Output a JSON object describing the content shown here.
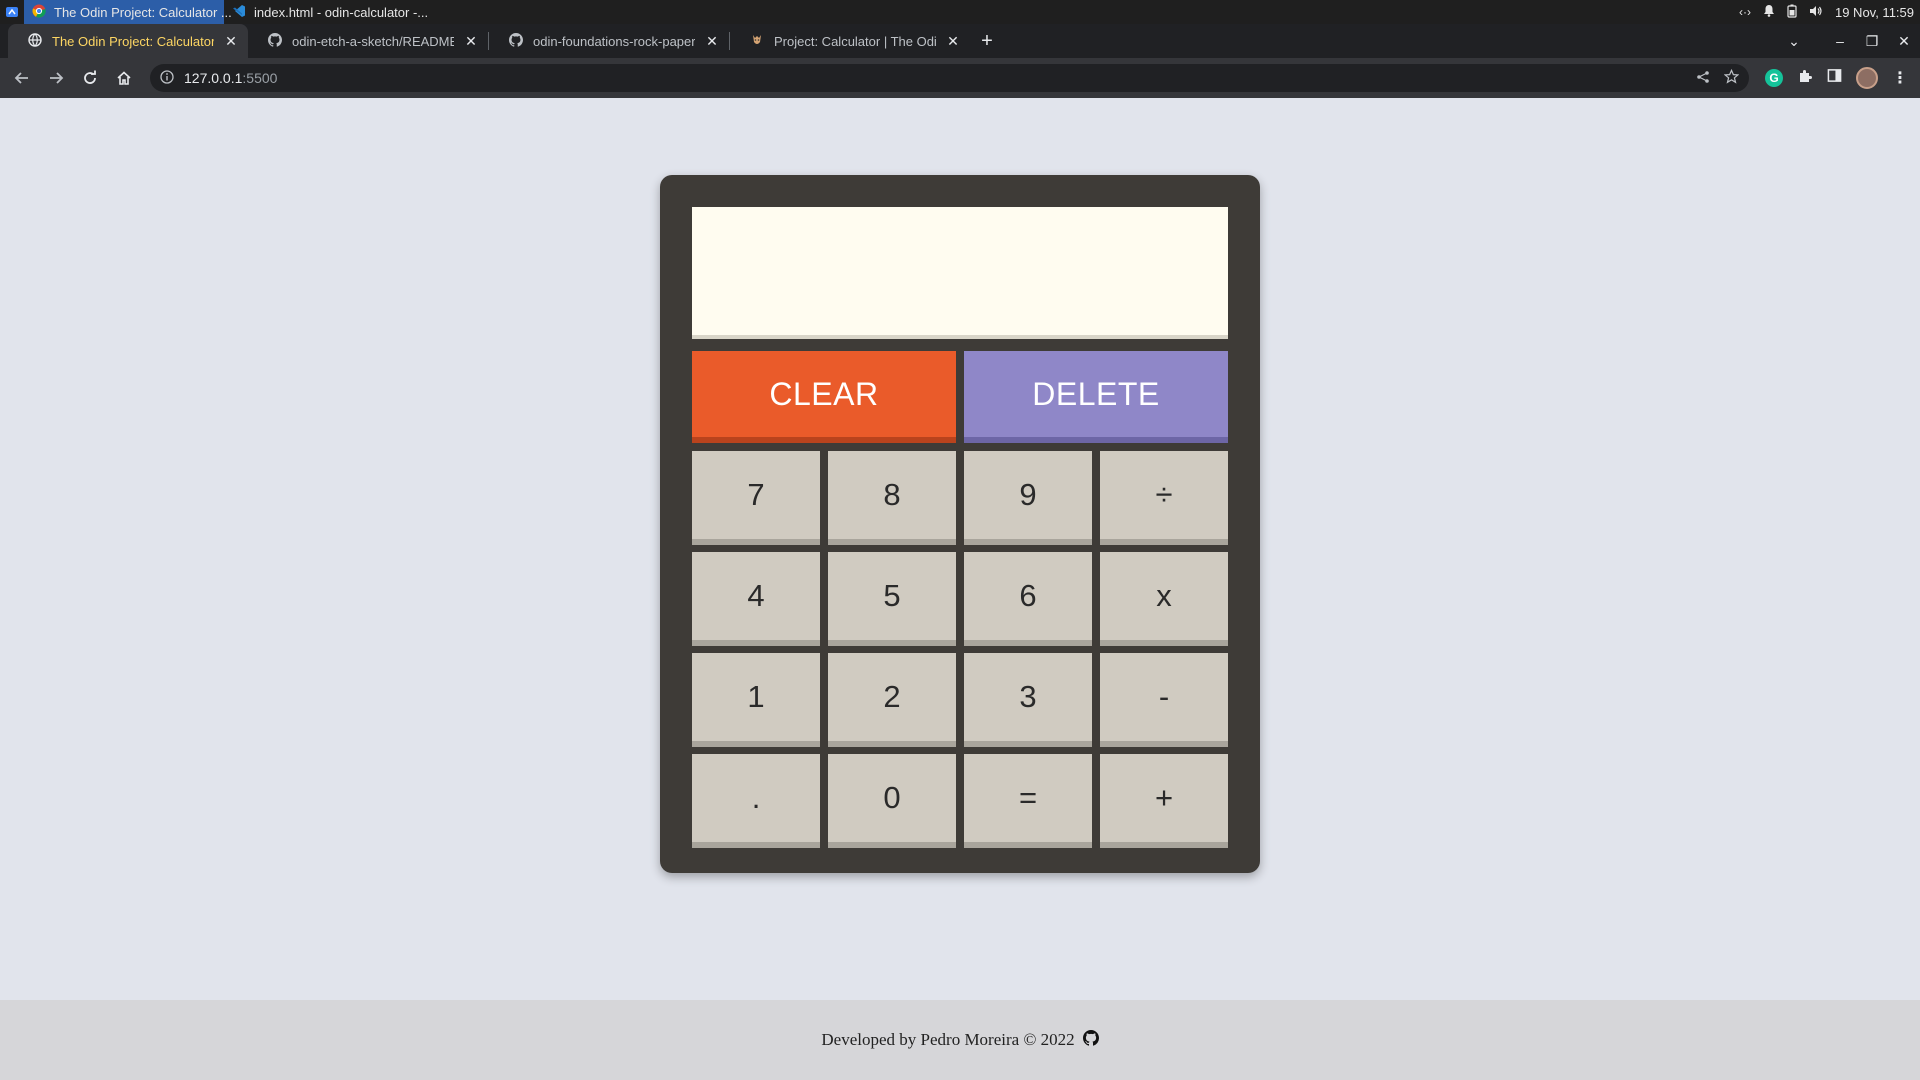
{
  "os": {
    "tasks": [
      {
        "label": "The Odin Project: Calculator ...",
        "icon": "chrome-icon"
      },
      {
        "label": "index.html - odin-calculator -...",
        "icon": "vscode-icon"
      }
    ],
    "clock": "19 Nov, 11:59"
  },
  "browser": {
    "tabs": [
      {
        "label": "The Odin Project: Calculator",
        "active": true
      },
      {
        "label": "odin-etch-a-sketch/README.md",
        "active": false
      },
      {
        "label": "odin-foundations-rock-paper-sc",
        "active": false
      },
      {
        "label": "Project: Calculator | The Odin P",
        "active": false
      }
    ],
    "new_tab": "+",
    "url_host": "127.0.0.1",
    "url_port": ":5500"
  },
  "calculator": {
    "display_value": "",
    "clear_label": "CLEAR",
    "delete_label": "DELETE",
    "keys": [
      {
        "label": "7",
        "name": "key-7"
      },
      {
        "label": "8",
        "name": "key-8"
      },
      {
        "label": "9",
        "name": "key-9"
      },
      {
        "label": "÷",
        "name": "key-divide"
      },
      {
        "label": "4",
        "name": "key-4"
      },
      {
        "label": "5",
        "name": "key-5"
      },
      {
        "label": "6",
        "name": "key-6"
      },
      {
        "label": "x",
        "name": "key-multiply"
      },
      {
        "label": "1",
        "name": "key-1"
      },
      {
        "label": "2",
        "name": "key-2"
      },
      {
        "label": "3",
        "name": "key-3"
      },
      {
        "label": "-",
        "name": "key-subtract"
      },
      {
        "label": ".",
        "name": "key-decimal"
      },
      {
        "label": "0",
        "name": "key-0"
      },
      {
        "label": "=",
        "name": "key-equals"
      },
      {
        "label": "+",
        "name": "key-add"
      }
    ]
  },
  "footer": {
    "text": "Developed by Pedro Moreira © 2022",
    "icon": "github-icon"
  },
  "colors": {
    "page_bg": "#e1e4ec",
    "calculator_body": "#3e3b37",
    "display_bg": "#fffcf0",
    "clear_button": "#ea5b2a",
    "delete_button": "#8f87c8",
    "key_bg": "#d0cbc1",
    "footer_bg": "#d6d6d9"
  }
}
